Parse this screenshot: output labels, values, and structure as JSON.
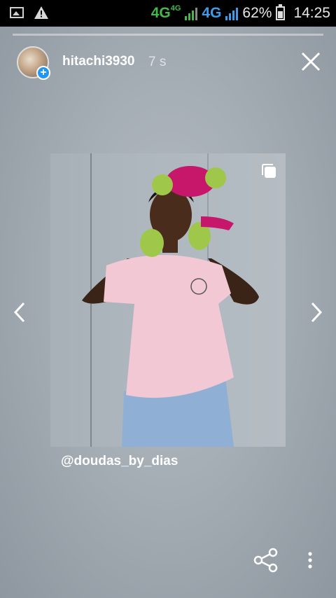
{
  "status_bar": {
    "network_1": "4G",
    "network_1_sub": "4G",
    "network_2": "4G",
    "battery": "62%",
    "battery_level": 0.62,
    "time": "14:25",
    "icons": [
      "image-notification-icon",
      "warning-icon",
      "signal-icon",
      "battery-icon"
    ]
  },
  "story": {
    "progress": 0.0,
    "username": "hitachi3930",
    "timestamp": "7 s",
    "caption": "@doudas_by_dias"
  },
  "controls": {
    "close": "close-icon",
    "prev": "chevron-left-icon",
    "next": "chevron-right-icon",
    "share": "share-icon",
    "more": "more-vertical-icon",
    "multi": "multiple-images-icon"
  },
  "colors": {
    "status_green": "#46b84a",
    "status_blue": "#3d9be9",
    "plus_badge": "#2196f3"
  }
}
